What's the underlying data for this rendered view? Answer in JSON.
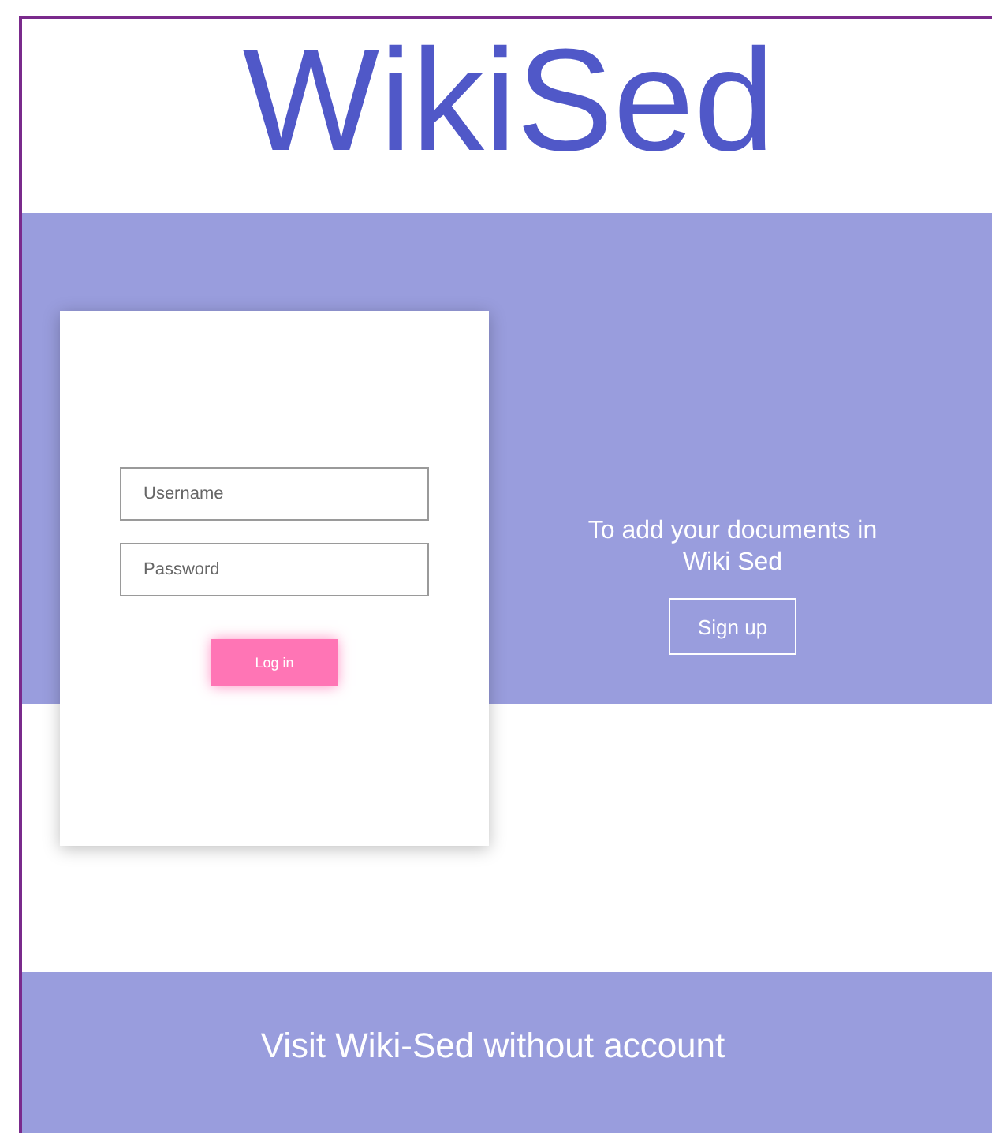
{
  "title": "WikiSed",
  "login": {
    "username": {
      "placeholder": "Username"
    },
    "password": {
      "placeholder": "Password"
    },
    "button": "Log in"
  },
  "signup": {
    "text": "To add your documents in Wiki Sed",
    "button": "Sign up"
  },
  "footer": {
    "link": "Visit Wiki-Sed without account"
  }
}
